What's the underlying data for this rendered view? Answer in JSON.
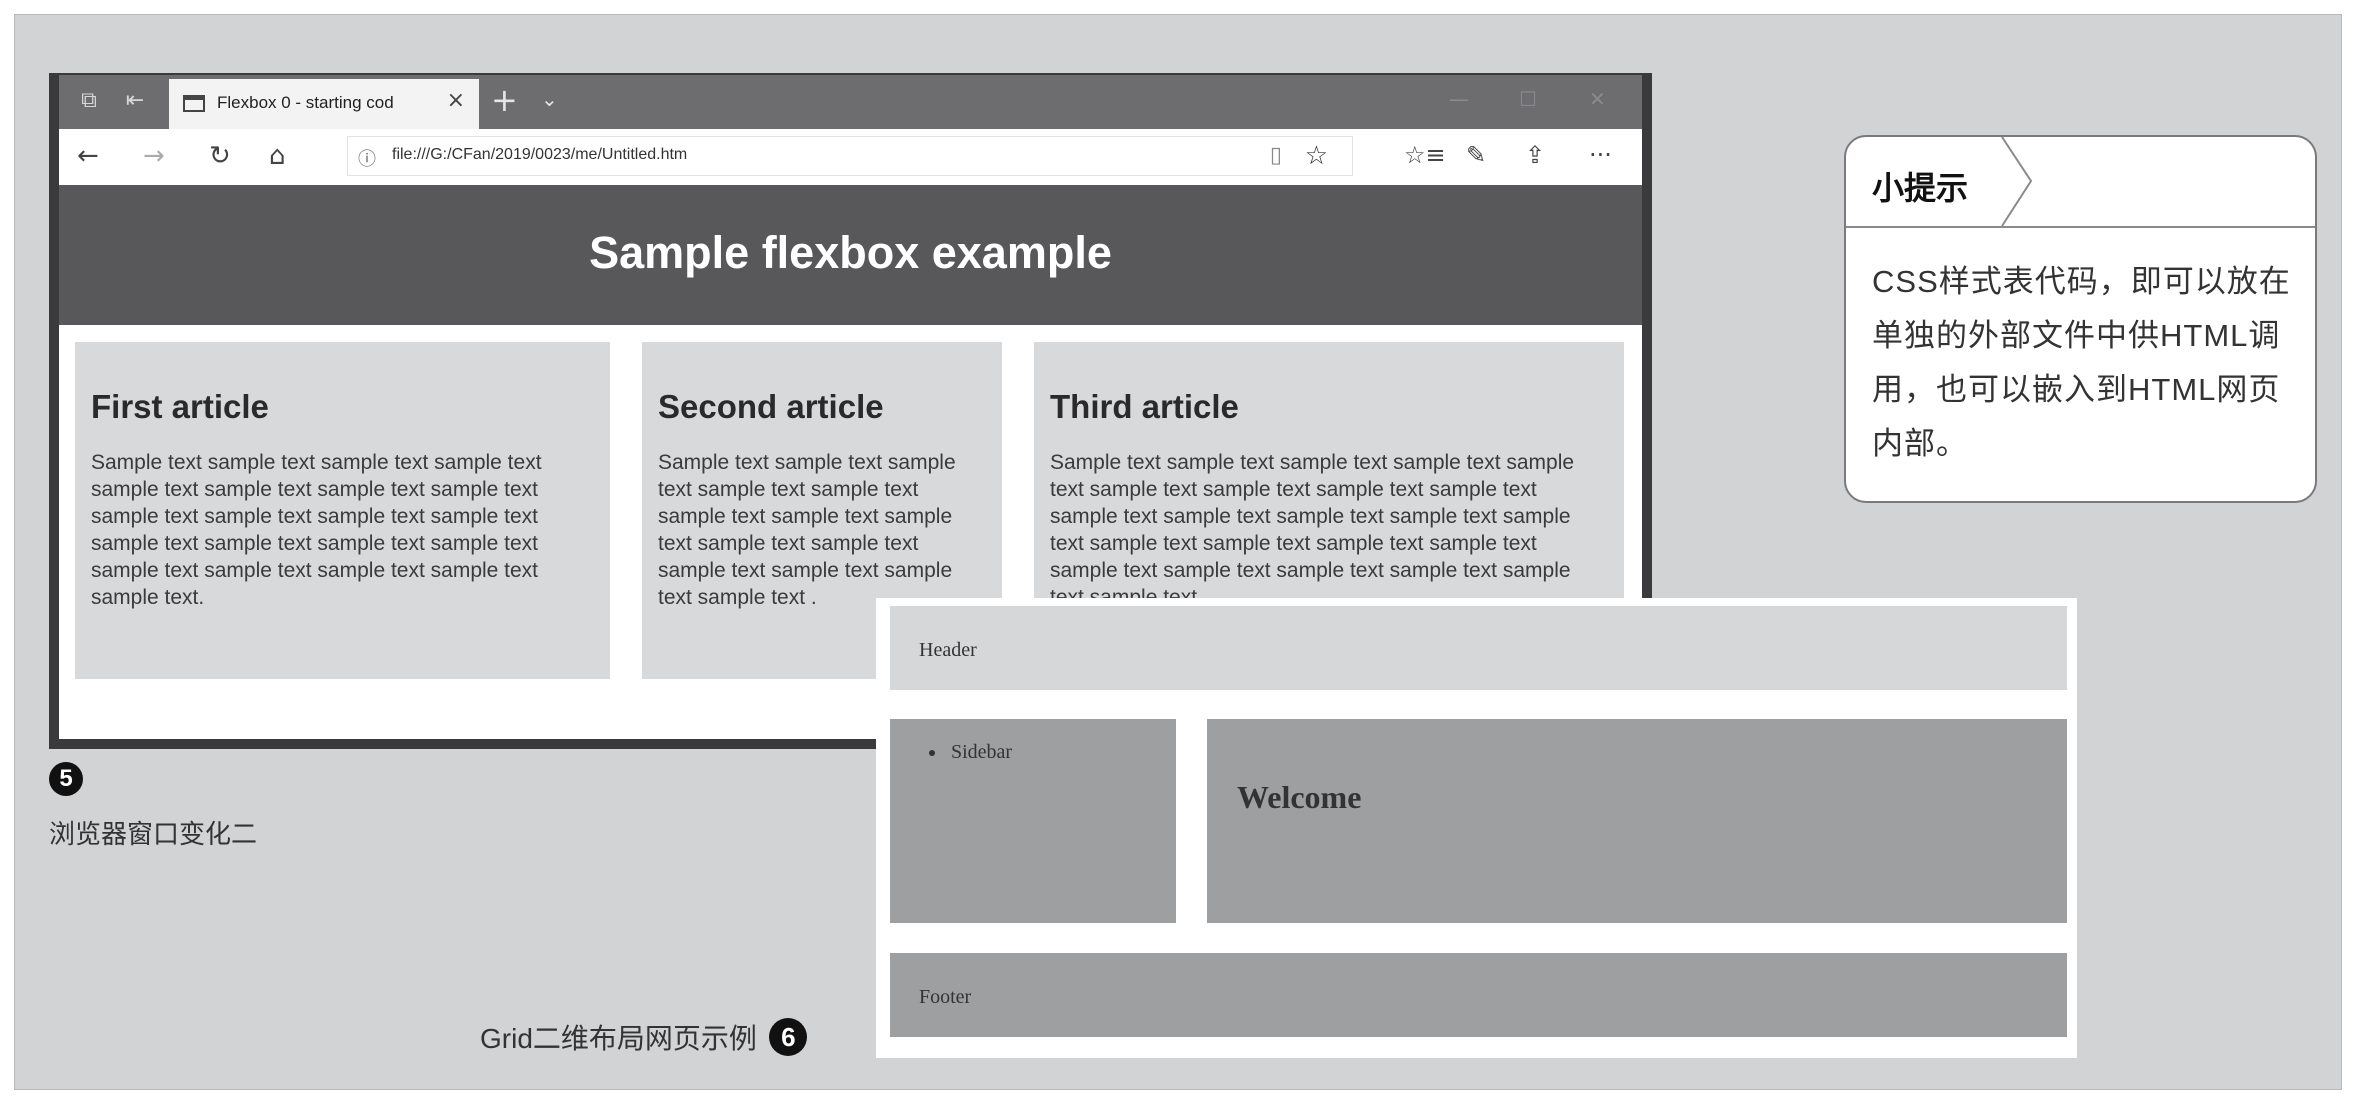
{
  "browser": {
    "tab_title": "Flexbox 0 - starting cod",
    "tab_close": "×",
    "new_tab": "+",
    "tab_menu": "⌄",
    "url": "file:///G:/CFan/2019/0023/me/Untitled.htm",
    "nav": {
      "back": "←",
      "forward": "→",
      "refresh": "↻",
      "home": "⌂"
    },
    "tools": {
      "info": "ⓘ",
      "reading_view": "▯",
      "favorite": "☆",
      "favorites_hub": "☆≡",
      "pen": "✎",
      "share": "⇪",
      "more": "···"
    }
  },
  "flexpage": {
    "header": "Sample flexbox example",
    "articles": [
      {
        "title": "First article",
        "text": "Sample text sample text sample text sample text sample text sample text sample text sample text sample text sample text sample text sample text sample text sample text sample text sample text sample text sample text sample text sample text sample text."
      },
      {
        "title": "Second article",
        "text": "Sample text sample text sample text sample text sample text sample text sample text sample text sample text sample text sample text sample text sample text sample text ."
      },
      {
        "title": "Third article",
        "text": "Sample text sample text sample text sample text sample text sample text sample text sample text sample text sample text sample text sample text sample text sample text sample text sample text sample text sample text sample text sample text sample text sample text sample text sample text."
      }
    ]
  },
  "captions": {
    "fig5_number": "5",
    "fig5_text": "浏览器窗口变化二",
    "fig6_text": "Grid二维布局网页示例",
    "fig6_number": "6"
  },
  "tip": {
    "title": "小提示",
    "body": "CSS样式表代码，即可以放在单独的外部文件中供HTML调用，也可以嵌入到HTML网页内部。"
  },
  "grid_example": {
    "header": "Header",
    "sidebar_item": "Sidebar",
    "main_title": "Welcome",
    "footer": "Footer"
  }
}
